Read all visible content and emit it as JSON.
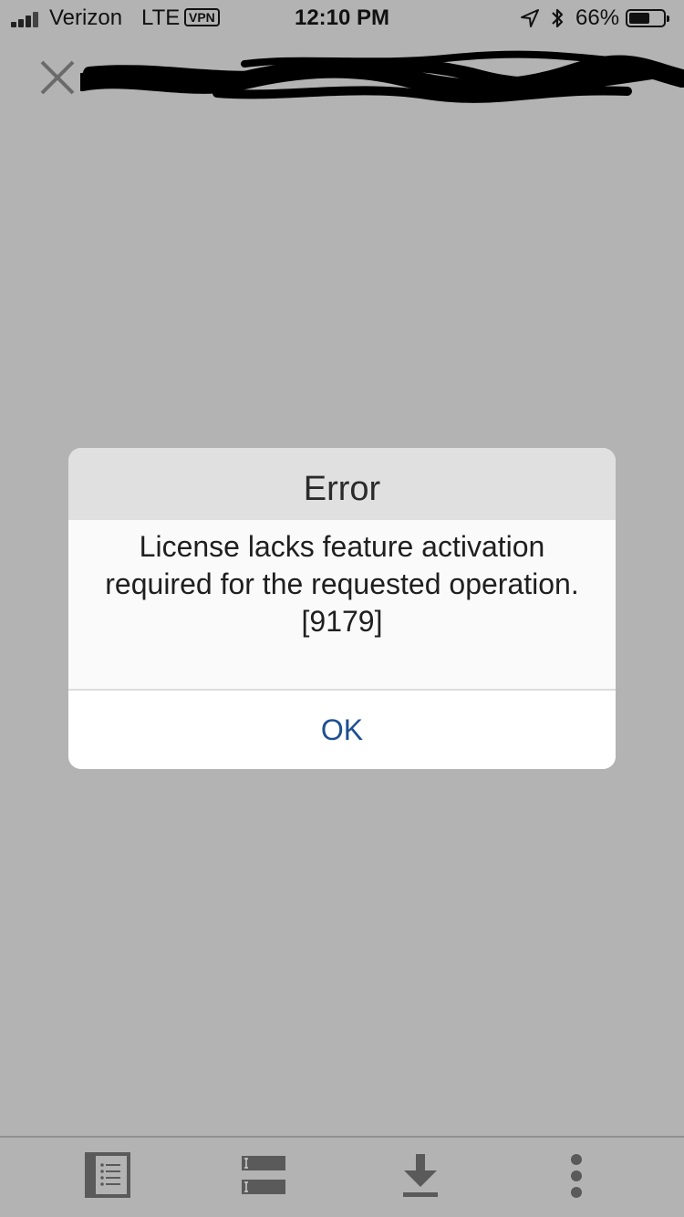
{
  "status_bar": {
    "carrier": "Verizon",
    "network": "LTE",
    "vpn": "VPN",
    "time": "12:10 PM",
    "battery_percent": "66%",
    "battery_level": 0.66
  },
  "top_bar": {
    "title_redacted": true
  },
  "dialog": {
    "title": "Error",
    "message_line1": "License lacks feature activation",
    "message_line2": "required for the requested operation.",
    "message_line3": "[9179]",
    "ok_label": "OK",
    "accent_color": "#1d4f91"
  },
  "toolbar": {
    "items": [
      "list-icon",
      "outline-icon",
      "download-icon",
      "more-vertical-icon"
    ]
  },
  "colors": {
    "overlay_background": "#b3b3b3",
    "dialog_header": "#e0e0e0",
    "icon_gray": "#5a5a5a"
  }
}
